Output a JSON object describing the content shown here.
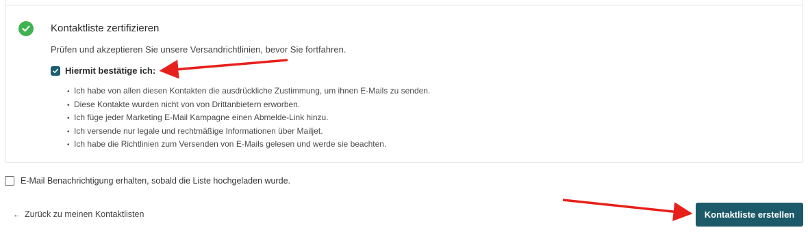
{
  "certify_section": {
    "status_icon": "check-circle-icon",
    "status_color": "#3fb34f",
    "title": "Kontaktliste zertifizieren",
    "description": "Prüfen und akzeptieren Sie unsere Versandrichtlinien, bevor Sie fortfahren.",
    "confirm_label": "Hiermit bestätige ich:",
    "confirm_checked": true,
    "rules": [
      "Ich habe von allen diesen Kontakten die ausdrückliche Zustimmung, um ihnen E-Mails zu senden.",
      "Diese Kontakte wurden nicht von von Drittanbietern erworben.",
      "Ich füge jeder Marketing E-Mail Kampagne einen Abmelde-Link hinzu.",
      "Ich versende nur legale und rechtmäßige Informationen über Mailjet.",
      "Ich habe die Richtlinien zum Versenden von E-Mails gelesen und werde sie beachten."
    ]
  },
  "notification": {
    "label": "E-Mail Benachrichtigung erhalten, sobald die Liste hochgeladen wurde.",
    "checked": false
  },
  "footer": {
    "back_arrow": "←",
    "back_label": "Zurück zu meinen Kontaktlisten",
    "submit_label": "Kontaktliste erstellen"
  },
  "colors": {
    "primary": "#1c5a69",
    "checkbox": "#1a5e6f",
    "annotation_arrow": "#e8201c"
  }
}
